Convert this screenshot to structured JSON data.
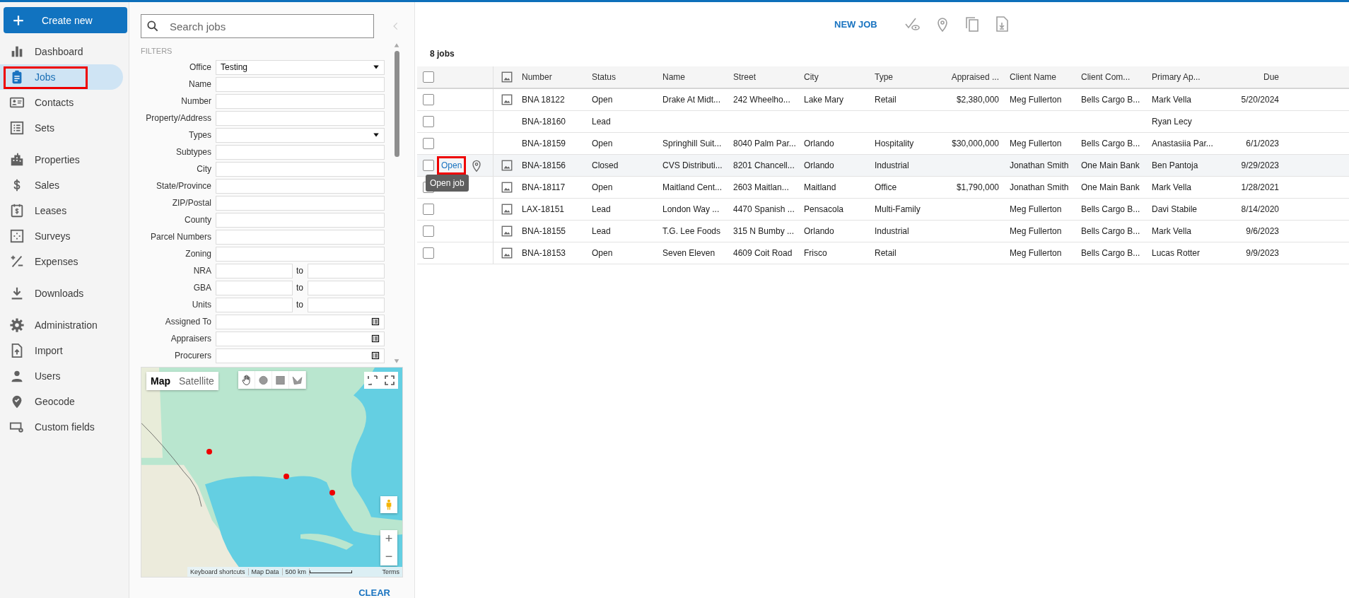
{
  "sidebar": {
    "create_button": "Create new",
    "groups": [
      [
        {
          "label": "Dashboard",
          "selected": false,
          "highlighted": false
        },
        {
          "label": "Jobs",
          "selected": true,
          "highlighted": true
        },
        {
          "label": "Contacts",
          "selected": false,
          "highlighted": false
        },
        {
          "label": "Sets",
          "selected": false,
          "highlighted": false
        }
      ],
      [
        {
          "label": "Properties",
          "selected": false,
          "highlighted": false
        },
        {
          "label": "Sales",
          "selected": false,
          "highlighted": false
        },
        {
          "label": "Leases",
          "selected": false,
          "highlighted": false
        },
        {
          "label": "Surveys",
          "selected": false,
          "highlighted": false
        },
        {
          "label": "Expenses",
          "selected": false,
          "highlighted": false
        }
      ],
      [
        {
          "label": "Downloads",
          "selected": false,
          "highlighted": false
        }
      ],
      [
        {
          "label": "Administration",
          "selected": false,
          "highlighted": false
        },
        {
          "label": "Import",
          "selected": false,
          "highlighted": false
        },
        {
          "label": "Users",
          "selected": false,
          "highlighted": false
        },
        {
          "label": "Geocode",
          "selected": false,
          "highlighted": false
        },
        {
          "label": "Custom fields",
          "selected": false,
          "highlighted": false
        }
      ]
    ]
  },
  "filter_panel": {
    "search": {
      "placeholder": "Search jobs"
    },
    "heading": "FILTERS",
    "filters": [
      {
        "label": "Office",
        "kind": "select",
        "value": "Testing"
      },
      {
        "label": "Name",
        "kind": "text"
      },
      {
        "label": "Number",
        "kind": "text"
      },
      {
        "label": "Property/Address",
        "kind": "text"
      },
      {
        "label": "Types",
        "kind": "select"
      },
      {
        "label": "Subtypes",
        "kind": "text"
      },
      {
        "label": "City",
        "kind": "text"
      },
      {
        "label": "State/Province",
        "kind": "text"
      },
      {
        "label": "ZIP/Postal",
        "kind": "text"
      },
      {
        "label": "County",
        "kind": "text"
      },
      {
        "label": "Parcel Numbers",
        "kind": "text"
      },
      {
        "label": "Zoning",
        "kind": "text"
      },
      {
        "label": "NRA",
        "kind": "range",
        "separator": "to"
      },
      {
        "label": "GBA",
        "kind": "range",
        "separator": "to"
      },
      {
        "label": "Units",
        "kind": "range",
        "separator": "to"
      },
      {
        "label": "Assigned To",
        "kind": "picker"
      },
      {
        "label": "Appraisers",
        "kind": "picker"
      },
      {
        "label": "Procurers",
        "kind": "picker"
      }
    ],
    "map": {
      "kind": "picture",
      "map_types": [
        {
          "label": "Map",
          "selected": true
        },
        {
          "label": "Satellite",
          "selected": false
        }
      ],
      "zoom_in": "+",
      "zoom_out": "−",
      "footer": [
        "Keyboard shortcuts",
        "Map Data",
        "500 km",
        "Terms"
      ]
    },
    "clear_button": "CLEAR"
  },
  "toolbar": {
    "new_job": "NEW JOB"
  },
  "job_count": "8 jobs",
  "table": {
    "header_checked": false,
    "columns": [
      "Number",
      "Status",
      "Name",
      "Street",
      "City",
      "Type",
      "Appraised ...",
      "Client Name",
      "Client Com...",
      "Primary Ap...",
      "Due"
    ],
    "rows": [
      {
        "checked": false,
        "has_image": true,
        "hovered": false,
        "cells": [
          "BNA 18122",
          "Open",
          "Drake At Midt...",
          "242 Wheelho...",
          "Lake Mary",
          "Retail",
          "$2,380,000",
          "Meg Fullerton",
          "Bells Cargo B...",
          "Mark Vella",
          "5/20/2024"
        ]
      },
      {
        "checked": false,
        "has_image": false,
        "hovered": false,
        "cells": [
          "BNA-18160",
          "Lead",
          "",
          "",
          "",
          "",
          "",
          "",
          "",
          "Ryan Lecy",
          ""
        ]
      },
      {
        "checked": false,
        "has_image": false,
        "hovered": false,
        "cells": [
          "BNA-18159",
          "Open",
          "Springhill Suit...",
          "8040 Palm Par...",
          "Orlando",
          "Hospitality",
          "$30,000,000",
          "Meg Fullerton",
          "Bells Cargo B...",
          "Anastasiia Par...",
          "6/1/2023"
        ]
      },
      {
        "checked": false,
        "has_image": true,
        "hovered": true,
        "open_link": "Open",
        "link_highlighted": true,
        "tooltip": "Open job",
        "cells": [
          "BNA-18156",
          "Closed",
          "CVS Distributi...",
          "8201 Chancell...",
          "Orlando",
          "Industrial",
          "",
          "Jonathan Smith",
          "One Main Bank",
          "Ben Pantoja",
          "9/29/2023"
        ]
      },
      {
        "checked": false,
        "has_image": true,
        "hovered": false,
        "cells": [
          "BNA-18117",
          "Open",
          "Maitland Cent...",
          "2603 Maitlan...",
          "Maitland",
          "Office",
          "$1,790,000",
          "Jonathan Smith",
          "One Main Bank",
          "Mark Vella",
          "1/28/2021"
        ]
      },
      {
        "checked": false,
        "has_image": true,
        "hovered": false,
        "cells": [
          "LAX-18151",
          "Lead",
          "London Way ...",
          "4470 Spanish ...",
          "Pensacola",
          "Multi-Family",
          "",
          "Meg Fullerton",
          "Bells Cargo B...",
          "Davi Stabile",
          "8/14/2020"
        ]
      },
      {
        "checked": false,
        "has_image": true,
        "hovered": false,
        "cells": [
          "BNA-18155",
          "Lead",
          "T.G. Lee Foods",
          "315 N Bumby ...",
          "Orlando",
          "Industrial",
          "",
          "Meg Fullerton",
          "Bells Cargo B...",
          "Mark Vella",
          "9/6/2023"
        ]
      },
      {
        "checked": false,
        "has_image": true,
        "hovered": false,
        "cells": [
          "BNA-18153",
          "Open",
          "Seven Eleven",
          "4609 Coit Road",
          "Frisco",
          "Retail",
          "",
          "Meg Fullerton",
          "Bells Cargo B...",
          "Lucas Rotter",
          "9/9/2023"
        ]
      }
    ]
  }
}
